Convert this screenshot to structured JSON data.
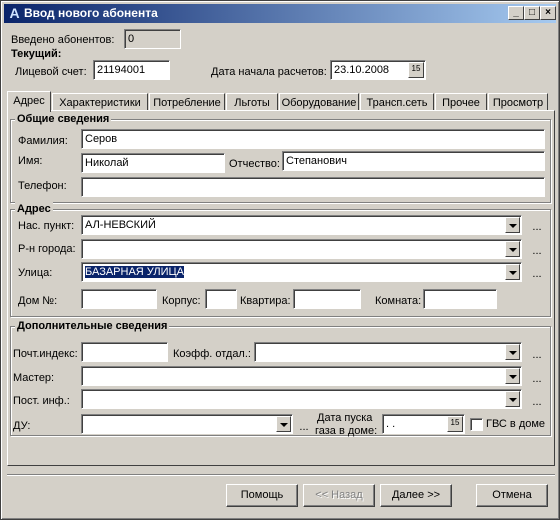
{
  "window": {
    "icon": "app-a-icon",
    "icon_glyph": "A",
    "title": "Ввод нового абонента",
    "min_glyph": "_",
    "max_glyph": "□",
    "close_glyph": "×"
  },
  "entered": {
    "label": "Введено абонентов:",
    "value": "0"
  },
  "current": {
    "title": "Текущий:",
    "account_label": "Лицевой счет:",
    "account_value": "21194001",
    "start_date_label": "Дата начала расчетов:",
    "start_date_value": "23.10.2008",
    "calendar_glyph": "15"
  },
  "tabs": [
    {
      "label": "Адрес"
    },
    {
      "label": "Характеристики"
    },
    {
      "label": "Потребление"
    },
    {
      "label": "Льготы"
    },
    {
      "label": "Оборудование"
    },
    {
      "label": "Трансп.сеть"
    },
    {
      "label": "Прочее"
    },
    {
      "label": "Просмотр"
    }
  ],
  "general": {
    "title": "Общие сведения",
    "surname_label": "Фамилия:",
    "surname_value": "Серов",
    "name_label": "Имя:",
    "name_value": "Николай",
    "patronymic_label": "Отчество:",
    "patronymic_value": "Степанович",
    "phone_label": "Телефон:",
    "phone_value": ""
  },
  "address": {
    "title": "Адрес",
    "locality_label": "Нас. пункт:",
    "locality_value": "АЛ-НЕВСКИЙ",
    "district_label": "Р-н города:",
    "district_value": "",
    "street_label": "Улица:",
    "street_value": "БАЗАРНАЯ УЛИЦА",
    "house_label": "Дом №:",
    "house_value": "",
    "building_label": "Корпус:",
    "building_value": "",
    "apartment_label": "Квартира:",
    "apartment_value": "",
    "room_label": "Комната:",
    "room_value": "",
    "dots": "..."
  },
  "extra": {
    "title": "Дополнительные сведения",
    "postcode_label": "Почт.индекс:",
    "postcode_value": "",
    "coef_label": "Коэфф. отдал.:",
    "coef_value": "",
    "master_label": "Мастер:",
    "master_value": "",
    "post_info_label": "Пост. инф.:",
    "post_info_value": "",
    "du_label": "ДУ:",
    "du_value": "",
    "gas_date_label_1": "Дата пуска",
    "gas_date_label_2": "газа в доме:",
    "gas_date_value": "  .  .",
    "gvs_label": "ГВС в доме",
    "gvs_checked": false
  },
  "buttons": {
    "help": "Помощь",
    "back": "<< Назад",
    "next": "Далее >>",
    "cancel": "Отмена"
  }
}
